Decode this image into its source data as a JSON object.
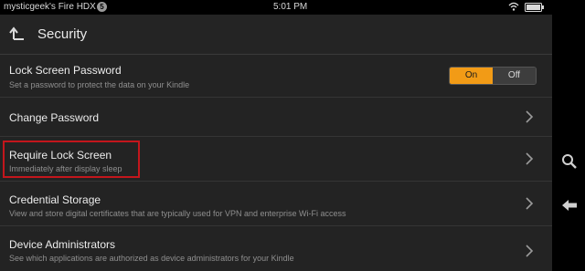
{
  "status_bar": {
    "device_name": "mysticgeek's Fire HDX",
    "notification_count": "5",
    "time": "5:01 PM"
  },
  "header": {
    "title": "Security"
  },
  "settings": [
    {
      "title": "Lock Screen Password",
      "subtitle": "Set a password to protect the data on your Kindle",
      "toggle": {
        "on_label": "On",
        "off_label": "Off",
        "state": "On"
      }
    },
    {
      "title": "Change Password"
    },
    {
      "title": "Require Lock Screen",
      "subtitle": "Immediately after display sleep"
    },
    {
      "title": "Credential Storage",
      "subtitle": "View and store digital certificates that are typically used for VPN and enterprise Wi-Fi access"
    },
    {
      "title": "Device Administrators",
      "subtitle": "See which applications are authorized as device administrators for your Kindle"
    }
  ],
  "colors": {
    "accent": "#f29b16",
    "highlight": "#c3161c",
    "background": "#232323"
  },
  "icons": [
    "wifi-icon",
    "battery-icon",
    "back-up-icon",
    "chevron-right-icon",
    "search-icon",
    "back-arrow-icon"
  ]
}
